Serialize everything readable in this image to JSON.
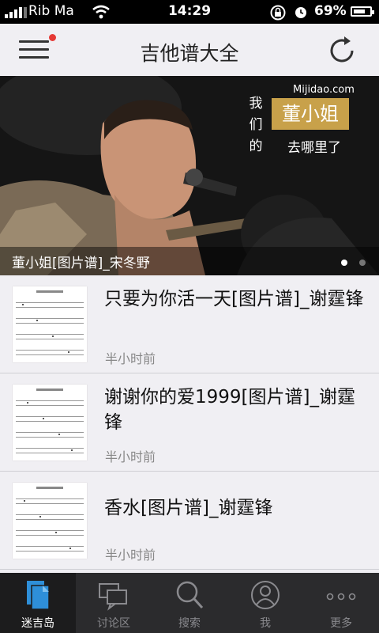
{
  "status": {
    "carrier": "Rib Ma",
    "time": "14:29",
    "battery": "69%"
  },
  "header": {
    "title": "吉他谱大全"
  },
  "banner": {
    "site": "Mijidao.com",
    "vertical_text": [
      "我",
      "们",
      "的"
    ],
    "boxed_text": "董小姐",
    "sub_text": "去哪里了",
    "caption": "董小姐[图片谱]_宋冬野",
    "page_count": 2,
    "active_page": 1
  },
  "items": [
    {
      "title": "只要为你活一天[图片谱]_谢霆锋",
      "time": "半小时前"
    },
    {
      "title": "谢谢你的爱1999[图片谱]_谢霆锋",
      "time": "半小时前"
    },
    {
      "title": "香水[图片谱]_谢霆锋",
      "time": "半小时前"
    }
  ],
  "tabs": [
    {
      "label": "迷吉岛",
      "icon": "document-icon",
      "active": true
    },
    {
      "label": "讨论区",
      "icon": "chat-icon",
      "active": false
    },
    {
      "label": "搜索",
      "icon": "search-icon",
      "active": false
    },
    {
      "label": "我",
      "icon": "user-icon",
      "active": false
    },
    {
      "label": "更多",
      "icon": "more-icon",
      "active": false
    }
  ],
  "colors": {
    "accent": "#2e8fd9",
    "notification": "#e53935",
    "banner_box": "#c8a14a"
  }
}
